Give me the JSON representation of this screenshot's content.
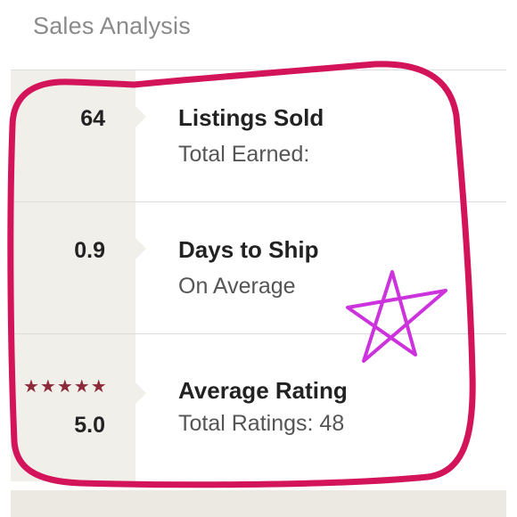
{
  "header": {
    "title": "Sales Analysis"
  },
  "stats": [
    {
      "value": "64",
      "title": "Listings Sold",
      "subtitle": "Total Earned:"
    },
    {
      "value": "0.9",
      "title": "Days to Ship",
      "subtitle": "On Average"
    },
    {
      "value": "5.0",
      "title": "Average Rating",
      "subtitle": "Total Ratings: 48",
      "stars": "★★★★★"
    }
  ],
  "colors": {
    "accent_circle": "#d4145a",
    "star_annotation": "#cc33dd",
    "rating_star": "#8c2a3a",
    "left_panel": "#f1efea"
  },
  "icons": {
    "rating": "star-icon",
    "annotation": "star-doodle-icon"
  }
}
